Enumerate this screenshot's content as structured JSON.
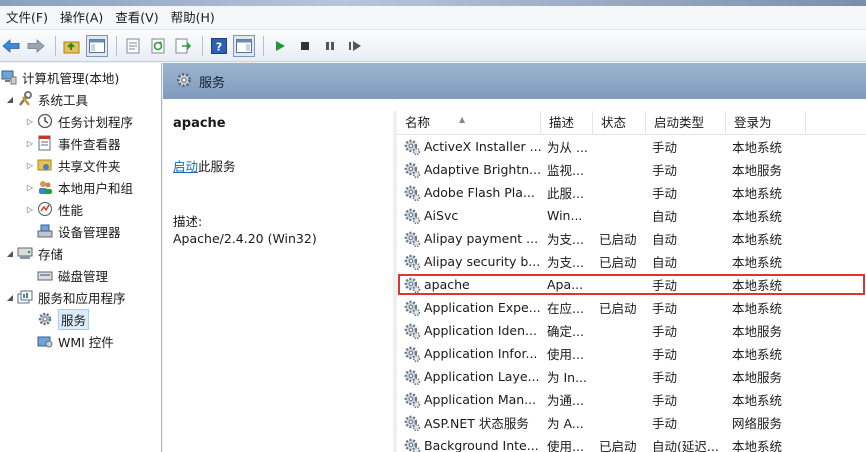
{
  "menubar": {
    "items": [
      "文件(F)",
      "操作(A)",
      "查看(V)",
      "帮助(H)"
    ]
  },
  "toolbar": {
    "buttons": [
      "back-arrow-icon",
      "forward-arrow-icon",
      "up-folder-icon",
      "console-tree-icon",
      "properties-icon",
      "refresh-icon",
      "export-list-icon",
      "help-icon",
      "show-hide-action-pane-icon",
      "play-icon",
      "stop-icon",
      "pause-icon",
      "restart-icon"
    ]
  },
  "tree": {
    "root": "计算机管理(本地)",
    "system_tools": "系统工具",
    "task_scheduler": "任务计划程序",
    "event_viewer": "事件查看器",
    "shared_folders": "共享文件夹",
    "local_users": "本地用户和组",
    "performance": "性能",
    "device_manager": "设备管理器",
    "storage": "存储",
    "disk_management": "磁盘管理",
    "services_apps": "服务和应用程序",
    "services": "服务",
    "wmi": "WMI 控件"
  },
  "pane": {
    "title": "服务"
  },
  "detail": {
    "service_name": "apache",
    "start_link": "启动",
    "start_suffix": "此服务",
    "desc_label": "描述:",
    "desc_value": "Apache/2.4.20 (Win32)"
  },
  "list": {
    "columns": [
      "名称",
      "描述",
      "状态",
      "启动类型",
      "登录为"
    ],
    "rows": [
      {
        "name": "ActiveX Installer ...",
        "desc": "为从 ...",
        "status": "",
        "startup": "手动",
        "logon": "本地系统"
      },
      {
        "name": "Adaptive Brightn...",
        "desc": "监视...",
        "status": "",
        "startup": "手动",
        "logon": "本地服务"
      },
      {
        "name": "Adobe Flash Pla...",
        "desc": "此服...",
        "status": "",
        "startup": "手动",
        "logon": "本地系统"
      },
      {
        "name": "AiSvc",
        "desc": "Win...",
        "status": "",
        "startup": "自动",
        "logon": "本地系统"
      },
      {
        "name": "Alipay payment ...",
        "desc": "为支...",
        "status": "已启动",
        "startup": "自动",
        "logon": "本地系统"
      },
      {
        "name": "Alipay security b...",
        "desc": "为支...",
        "status": "已启动",
        "startup": "自动",
        "logon": "本地系统"
      },
      {
        "name": "apache",
        "desc": "Apa...",
        "status": "",
        "startup": "手动",
        "logon": "本地系统"
      },
      {
        "name": "Application Expe...",
        "desc": "在应...",
        "status": "已启动",
        "startup": "手动",
        "logon": "本地系统"
      },
      {
        "name": "Application Iden...",
        "desc": "确定...",
        "status": "",
        "startup": "手动",
        "logon": "本地服务"
      },
      {
        "name": "Application Infor...",
        "desc": "使用...",
        "status": "",
        "startup": "手动",
        "logon": "本地系统"
      },
      {
        "name": "Application Laye...",
        "desc": "为 In...",
        "status": "",
        "startup": "手动",
        "logon": "本地服务"
      },
      {
        "name": "Application Man...",
        "desc": "为通...",
        "status": "",
        "startup": "手动",
        "logon": "本地系统"
      },
      {
        "name": "ASP.NET 状态服务",
        "desc": "为 A...",
        "status": "",
        "startup": "手动",
        "logon": "网络服务"
      },
      {
        "name": "Background Inte...",
        "desc": "使用...",
        "status": "已启动",
        "startup": "自动(延迟...",
        "logon": "本地系统"
      }
    ]
  }
}
